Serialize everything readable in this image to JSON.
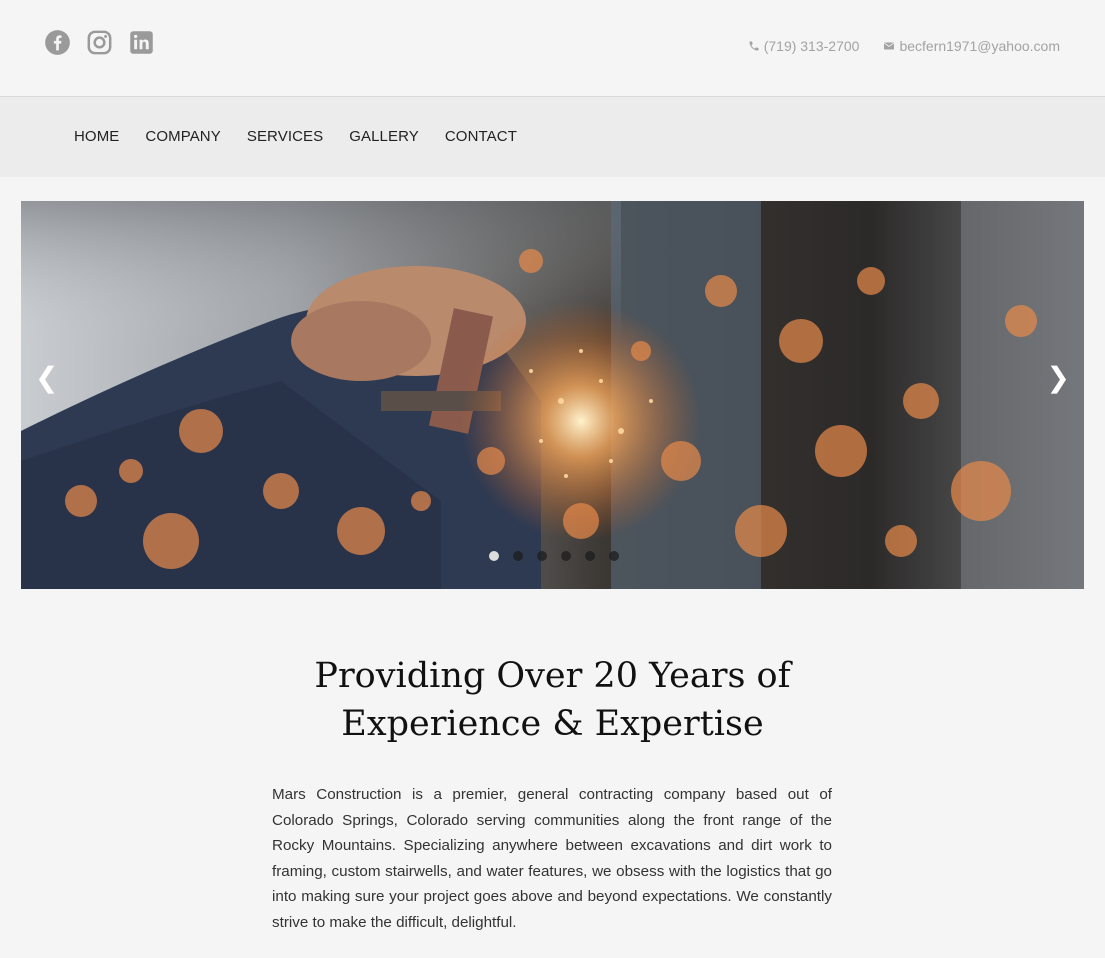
{
  "social": {
    "icons": [
      "facebook-icon",
      "instagram-icon",
      "linkedin-icon"
    ]
  },
  "contact": {
    "phone": "(719) 313-2700",
    "email": "becfern1971@yahoo.com"
  },
  "nav": {
    "items": [
      "HOME",
      "COMPANY",
      "SERVICES",
      "GALLERY",
      "CONTACT"
    ]
  },
  "slider": {
    "prev_label": "❮",
    "next_label": "❯",
    "slide_count": 6,
    "active_slide": 1
  },
  "headline": {
    "line1": "Providing Over 20 Years of",
    "line2": "Experience & Expertise"
  },
  "intro": {
    "text": "Mars Construction is a premier, general contracting company based out of Colorado Springs, Colorado serving communities along the front range of the Rocky Mountains. Specializing anywhere between excavations and dirt work to framing, custom stairwells, and water features, we obsess with the logistics that go into making sure your project goes above and beyond expectations. We constantly strive to make the difficult, delightful."
  },
  "colors": {
    "icon_gray": "#9a9a9a",
    "nav_bg": "#ececec",
    "page_bg": "#f5f5f5"
  }
}
